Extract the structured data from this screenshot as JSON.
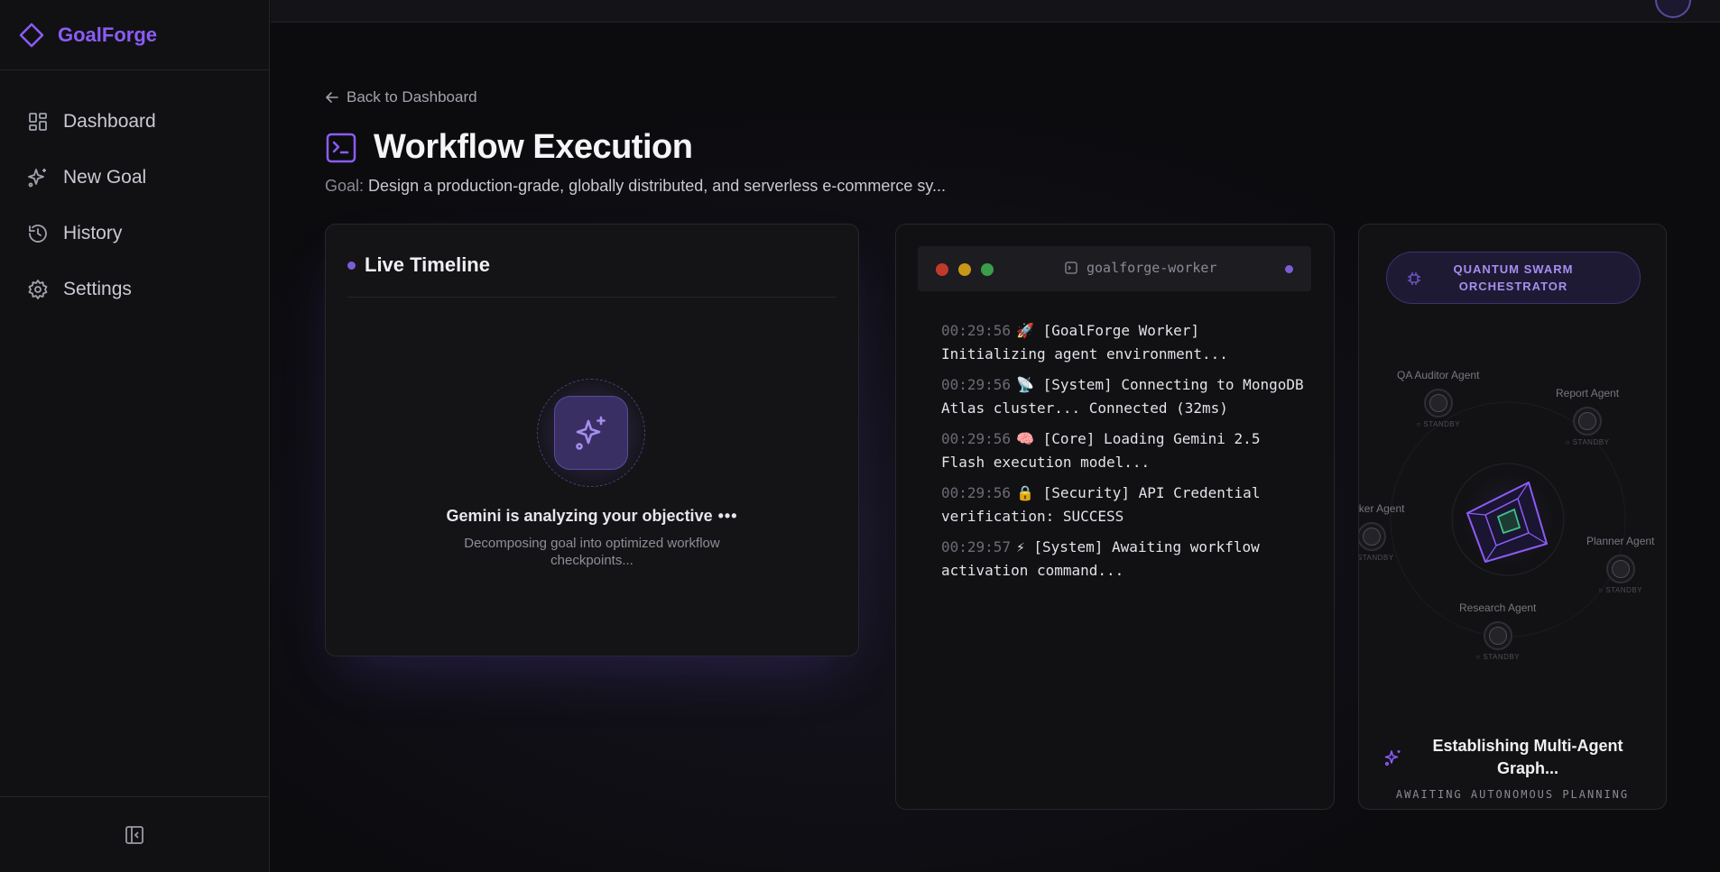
{
  "app": {
    "name": "GoalForge"
  },
  "sidebar": {
    "items": [
      {
        "label": "Dashboard",
        "icon": "dashboard-icon"
      },
      {
        "label": "New Goal",
        "icon": "sparkles-icon"
      },
      {
        "label": "History",
        "icon": "history-icon"
      },
      {
        "label": "Settings",
        "icon": "gear-icon"
      }
    ],
    "collapse_icon": "collapse-sidebar-icon"
  },
  "header": {
    "back_label": "Back to Dashboard",
    "title": "Workflow Execution",
    "goal_label": "Goal:",
    "goal_text": "Design a production-grade, globally distributed, and serverless e-commerce sy..."
  },
  "timeline": {
    "title": "Live Timeline",
    "status": "Gemini is analyzing your objective",
    "dots": "•••",
    "substatus": "Decomposing goal into optimized workflow checkpoints..."
  },
  "terminal": {
    "name": "goalforge-worker",
    "logs": [
      {
        "time": "00:29:56",
        "icon": "🚀",
        "text": "[GoalForge Worker] Initializing agent environment..."
      },
      {
        "time": "00:29:56",
        "icon": "📡",
        "text": "[System] Connecting to MongoDB Atlas cluster... Connected (32ms)"
      },
      {
        "time": "00:29:56",
        "icon": "🧠",
        "text": "[Core] Loading Gemini 2.5 Flash execution model..."
      },
      {
        "time": "00:29:56",
        "icon": "🔒",
        "text": "[Security] API Credential verification: SUCCESS"
      },
      {
        "time": "00:29:57",
        "icon": "⚡",
        "text": "[System] Awaiting workflow activation command..."
      }
    ]
  },
  "swarm": {
    "badge_line1": "QUANTUM SWARM",
    "badge_line2": "ORCHESTRATOR",
    "agents": [
      {
        "name": "QA Auditor Agent",
        "status": "○ STANDBY"
      },
      {
        "name": "Report Agent",
        "status": "○ STANDBY"
      },
      {
        "name": "Worker Agent",
        "status": "○ STANDBY"
      },
      {
        "name": "Planner Agent",
        "status": "○ STANDBY"
      },
      {
        "name": "Research Agent",
        "status": "○ STANDBY"
      }
    ],
    "establishing": "Establishing Multi-Agent Graph...",
    "awaiting": "AWAITING AUTONOMOUS PLANNING"
  },
  "colors": {
    "accent": "#8b5cf6",
    "background": "#0c0c0f"
  }
}
